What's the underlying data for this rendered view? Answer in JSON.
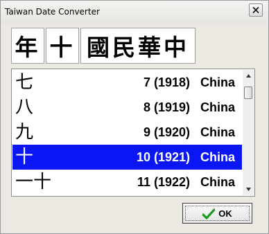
{
  "window": {
    "title": "Taiwan Date Converter",
    "close_icon": "close-icon"
  },
  "header": {
    "buttons": [
      {
        "text": "年"
      },
      {
        "text": "十"
      },
      {
        "text": "國民華中"
      }
    ]
  },
  "list": {
    "rows": [
      {
        "han": "七",
        "year": "7 (1918)",
        "country": "China",
        "selected": false
      },
      {
        "han": "八",
        "year": "8 (1919)",
        "country": "China",
        "selected": false
      },
      {
        "han": "九",
        "year": "9 (1920)",
        "country": "China",
        "selected": false
      },
      {
        "han": "十",
        "year": "10 (1921)",
        "country": "China",
        "selected": true
      },
      {
        "han": "一十",
        "year": "11 (1922)",
        "country": "China",
        "selected": false
      }
    ],
    "selected_color": "#0a16f4",
    "scroll_up_icon": "scroll-up-arrow-icon",
    "scroll_down_icon": "scroll-down-arrow-icon"
  },
  "ok_button": {
    "label": "OK",
    "icon": "checkmark-icon",
    "icon_color": "#1a9a1a"
  }
}
